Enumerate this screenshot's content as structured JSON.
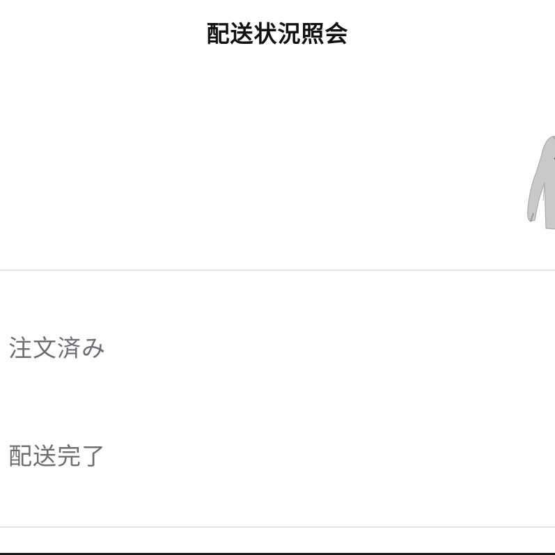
{
  "header": {
    "title": "配送状況照会"
  },
  "product": {
    "image_icon": "hoodie-image"
  },
  "status": {
    "items": [
      {
        "label": "注文済み"
      },
      {
        "label": "配送完了"
      }
    ]
  },
  "colors": {
    "title": "#111111",
    "status_text": "#6b6f73",
    "divider": "#e3e3e3",
    "background": "#ffffff"
  }
}
